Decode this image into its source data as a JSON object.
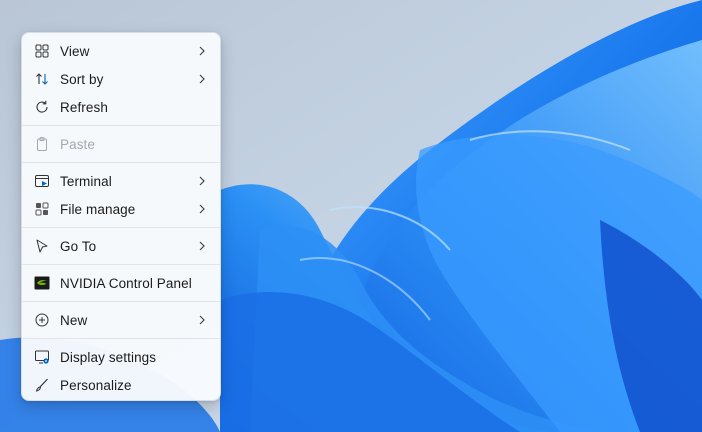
{
  "menu": {
    "view": "View",
    "sort_by": "Sort by",
    "refresh": "Refresh",
    "paste": "Paste",
    "terminal": "Terminal",
    "file_manage": "File manage",
    "go_to": "Go To",
    "nvidia": "NVIDIA Control Panel",
    "new": "New",
    "display_settings": "Display settings",
    "personalize": "Personalize"
  },
  "icons": {
    "view": "grid-icon",
    "sort_by": "sort-arrows-icon",
    "refresh": "refresh-icon",
    "paste": "clipboard-icon",
    "terminal": "terminal-icon",
    "file_manage": "apps-grid-icon",
    "go_to": "cursor-pointer-icon",
    "nvidia": "nvidia-logo-icon",
    "new": "plus-circle-icon",
    "display_settings": "display-settings-icon",
    "personalize": "brush-icon",
    "submenu": "chevron-right-icon"
  },
  "colors": {
    "accent": "#0067c0",
    "nvidia_green": "#76b900",
    "wallpaper_blue": "#1e7ef0"
  }
}
